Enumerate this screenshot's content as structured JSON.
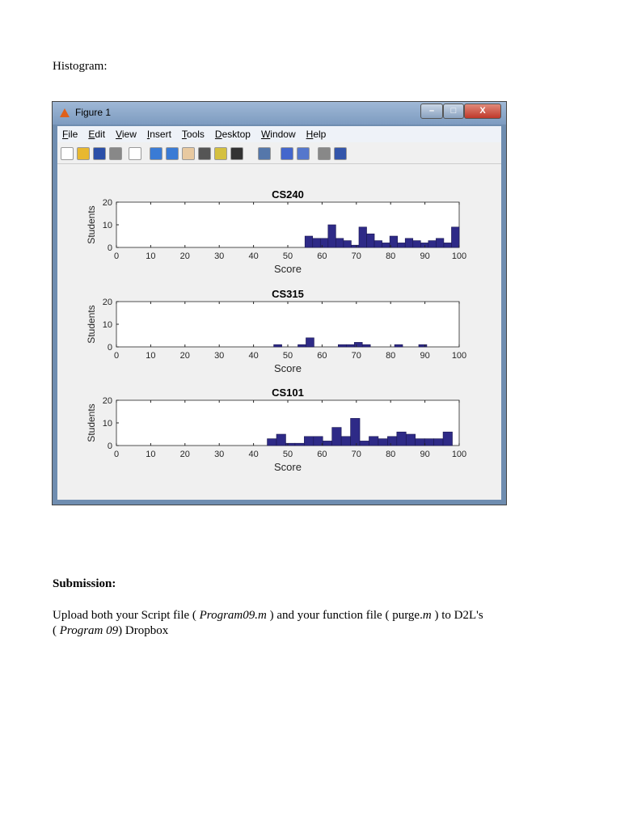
{
  "heading": "Histogram:",
  "window": {
    "title": "Figure 1",
    "controls": [
      "–",
      "□",
      "X"
    ],
    "menu": [
      "File",
      "Edit",
      "View",
      "Insert",
      "Tools",
      "Desktop",
      "Window",
      "Help"
    ],
    "toolbar_icons": [
      "new-file-icon",
      "open-folder-icon",
      "save-icon",
      "print-icon",
      "pointer-icon",
      "zoom-in-icon",
      "zoom-out-icon",
      "pan-hand-icon",
      "rotate-3d-icon",
      "data-cursor-icon",
      "brush-icon",
      "link-plot-icon",
      "colorbar-icon",
      "legend-icon",
      "hide-plot-tools-icon",
      "show-plot-tools-icon"
    ]
  },
  "chart_data": [
    {
      "type": "bar",
      "title": "CS240",
      "xlabel": "Score",
      "ylabel": "Students",
      "xlim": [
        0,
        100
      ],
      "ylim": [
        0,
        20
      ],
      "xticks": [
        0,
        10,
        20,
        30,
        40,
        50,
        60,
        70,
        80,
        90,
        100
      ],
      "yticks": [
        0,
        10,
        20
      ],
      "bin_start": 55,
      "bin_width": 2.25,
      "values": [
        5,
        4,
        4,
        10,
        4,
        3,
        1,
        9,
        6,
        3,
        2,
        5,
        2,
        4,
        3,
        2,
        3,
        4,
        2,
        9
      ]
    },
    {
      "type": "bar",
      "title": "CS315",
      "xlabel": "Score",
      "ylabel": "Students",
      "xlim": [
        0,
        100
      ],
      "ylim": [
        0,
        20
      ],
      "xticks": [
        0,
        10,
        20,
        30,
        40,
        50,
        60,
        70,
        80,
        90,
        100
      ],
      "yticks": [
        0,
        10,
        20
      ],
      "bin_start": 45.9,
      "bin_width": 2.35,
      "values": [
        1,
        0,
        0,
        1,
        4,
        0,
        0,
        0,
        1,
        1,
        2,
        1,
        0,
        0,
        0,
        1,
        0,
        0,
        1
      ]
    },
    {
      "type": "bar",
      "title": "CS101",
      "xlabel": "Score",
      "ylabel": "Students",
      "xlim": [
        0,
        100
      ],
      "ylim": [
        0,
        20
      ],
      "xticks": [
        0,
        10,
        20,
        30,
        40,
        50,
        60,
        70,
        80,
        90,
        100
      ],
      "yticks": [
        0,
        10,
        20
      ],
      "bin_start": 44,
      "bin_width": 2.7,
      "values": [
        3,
        5,
        1,
        1,
        4,
        4,
        2,
        8,
        4,
        12,
        2,
        4,
        3,
        4,
        6,
        5,
        3,
        3,
        3,
        6
      ]
    }
  ],
  "submission": {
    "title": "Submission:",
    "line1_a": "Upload both your Script file  ( ",
    "script": "Program09.m",
    "line1_b": " )  and  your function file ( purge.",
    "ext": "m",
    "line1_c": " ) to D2L's",
    "line2_a": "( ",
    "program": "Program 09",
    "line2_b": ")  Dropbox"
  }
}
